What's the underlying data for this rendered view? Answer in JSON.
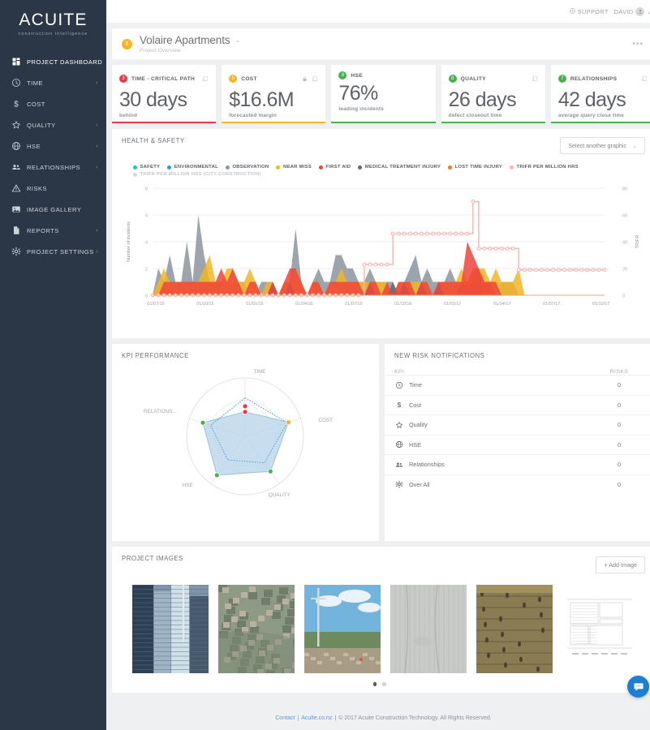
{
  "brand": {
    "logo_text": "ACUITE",
    "logo_tagline": "construction intelligence"
  },
  "topbar": {
    "support_label": "SUPPORT",
    "user_name": "DAVID",
    "support_icon": "help-circle-icon",
    "avatar_icon": "user-avatar-icon",
    "caret_icon": "chevron-down-icon"
  },
  "sidebar": {
    "items": [
      {
        "label": "PROJECT DASHBOARD",
        "icon": "grid-icon",
        "has_caret": false,
        "active": true
      },
      {
        "label": "TIME",
        "icon": "clock-icon",
        "has_caret": true,
        "active": false
      },
      {
        "label": "COST",
        "icon": "dollar-icon",
        "has_caret": false,
        "active": false
      },
      {
        "label": "QUALITY",
        "icon": "star-icon",
        "has_caret": true,
        "active": false
      },
      {
        "label": "HSE",
        "icon": "helmet-icon",
        "has_caret": true,
        "active": false
      },
      {
        "label": "RELATIONSHIPS",
        "icon": "people-icon",
        "has_caret": true,
        "active": false
      },
      {
        "label": "RISKS",
        "icon": "warning-triangle-icon",
        "has_caret": false,
        "active": false
      },
      {
        "label": "IMAGE GALLERY",
        "icon": "image-icon",
        "has_caret": false,
        "active": false
      },
      {
        "label": "REPORTS",
        "icon": "document-icon",
        "has_caret": true,
        "active": false
      },
      {
        "label": "PROJECT SETTINGS",
        "icon": "gear-icon",
        "has_caret": true,
        "active": false
      }
    ]
  },
  "project_header": {
    "badge": "6",
    "badge_color": "#f5b526",
    "title": "Volaire Apartments",
    "subtitle": "Project Overview",
    "caret_icon": "chevron-down-icon",
    "overflow_icon": "ellipsis-icon"
  },
  "kpi_cards": [
    {
      "badge": "3",
      "badge_color": "#e8394a",
      "name": "TIME - CRITICAL PATH",
      "value": "30",
      "unit": "days",
      "description": "behind",
      "bar_color": "#e8394a",
      "has_lock": false,
      "has_copy": true
    },
    {
      "badge": "5",
      "badge_color": "#f5b526",
      "name": "COST",
      "value": "$16.6M",
      "unit": "",
      "description": "forecasted margin",
      "bar_color": "#f5b526",
      "has_lock": true,
      "has_copy": true
    },
    {
      "badge": "8",
      "badge_color": "#4caf50",
      "name": "HSE",
      "value": "76%",
      "unit": "",
      "description": "leading incidents",
      "bar_color": "#4caf50",
      "has_lock": false,
      "has_copy": false
    },
    {
      "badge": "8",
      "badge_color": "#4caf50",
      "name": "QUALITY",
      "value": "26",
      "unit": "days",
      "description": "defect closeout time",
      "bar_color": "#4caf50",
      "has_lock": false,
      "has_copy": true
    },
    {
      "badge": "7",
      "badge_color": "#4caf50",
      "name": "RELATIONSHIPS",
      "value": "42",
      "unit": "days",
      "description": "average query close time",
      "bar_color": "#4caf50",
      "has_lock": false,
      "has_copy": true
    }
  ],
  "health_safety": {
    "title": "HEALTH & SAFETY",
    "select_label": "Select another graphic",
    "select_caret": "chevron-down-icon"
  },
  "kpi_performance": {
    "title": "KPI PERFORMANCE"
  },
  "risk_notifications": {
    "title": "NEW RISK NOTIFICATIONS",
    "columns": {
      "kpi": "KPI",
      "risks": "RISKS"
    },
    "rows": [
      {
        "label": "Time",
        "icon": "clock-icon",
        "risks": "0"
      },
      {
        "label": "Cost",
        "icon": "dollar-icon",
        "risks": "0"
      },
      {
        "label": "Quality",
        "icon": "star-icon",
        "risks": "0"
      },
      {
        "label": "HSE",
        "icon": "helmet-icon",
        "risks": "0"
      },
      {
        "label": "Relationships",
        "icon": "people-icon",
        "risks": "0"
      },
      {
        "label": "Over All",
        "icon": "gear-icon",
        "risks": "0"
      }
    ]
  },
  "project_images": {
    "title": "PROJECT IMAGES",
    "add_button": "+ Add Image",
    "thumbnails": [
      {
        "alt": "high-rise-towers-photo"
      },
      {
        "alt": "aerial-city-site-photo"
      },
      {
        "alt": "construction-site-crane-photo"
      },
      {
        "alt": "concrete-wall-closeup-photo"
      },
      {
        "alt": "timber-formwork-photo"
      },
      {
        "alt": "floor-plan-drawing"
      }
    ],
    "page_dots": 2,
    "active_dot": 0
  },
  "footer": {
    "contact": "Contact",
    "site": "Aculte.co.nz",
    "copyright": "© 2017 Acuite Construction Technology. All Rights Reserved.",
    "sep": "|"
  },
  "chat": {
    "icon": "chat-bubble-icon"
  },
  "chart_data": [
    {
      "type": "area",
      "name": "health-and-safety-incidents",
      "title": "HEALTH & SAFETY",
      "xlabel": "",
      "ylabel": "Number of incidents",
      "y2label": "TRIFR",
      "ylim": [
        0,
        8
      ],
      "y2lim": [
        0,
        80
      ],
      "yticks": [
        0,
        2,
        4,
        6,
        8
      ],
      "y2ticks": [
        0,
        20,
        40,
        60,
        80
      ],
      "grid": true,
      "legend_position": "top",
      "xticks": [
        "01/07/15",
        "01/10/15",
        "01/01/16",
        "01/04/16",
        "01/07/16",
        "01/10/16",
        "01/01/17",
        "01/04/17",
        "01/07/17",
        "01/10/17"
      ],
      "legend": [
        {
          "name": "SAFETY",
          "color": "#1dc9b7"
        },
        {
          "name": "ENVIRONMENTAL",
          "color": "#3498db"
        },
        {
          "name": "OBSERVATION",
          "color": "#8d949c"
        },
        {
          "name": "NEAR MISS",
          "color": "#f5b526"
        },
        {
          "name": "FIRST AID",
          "color": "#f0453a"
        },
        {
          "name": "MEDICAL TREATMENT INJURY",
          "color": "#5c6b7a"
        },
        {
          "name": "LOST TIME INJURY",
          "color": "#f07c22"
        },
        {
          "name": "TRIFR PER MILLION HRS",
          "color": "#f9b3b0"
        },
        {
          "name": "TRIFR PER MILLION HRS (CITY CONSTRUCTION)",
          "color": "#d6d9dd",
          "dim": true
        }
      ],
      "series": [
        {
          "name": "OBSERVATION",
          "color": "#8d949c",
          "values": [
            0,
            2,
            1,
            3,
            1,
            1,
            4,
            1,
            6,
            3,
            1,
            1,
            1,
            0,
            1,
            1,
            1,
            0,
            0,
            1,
            1,
            1,
            0,
            1,
            1,
            5,
            1,
            0,
            1,
            2,
            1,
            1,
            3,
            3,
            2,
            2,
            1,
            1,
            2,
            1,
            1,
            1,
            1,
            0,
            1,
            2,
            3,
            1,
            2,
            1,
            1,
            1,
            2,
            1,
            1,
            1,
            0,
            1,
            1,
            1,
            0,
            1,
            1,
            1,
            0,
            0,
            0,
            0,
            0,
            0,
            0,
            0,
            0,
            0,
            0,
            0,
            0,
            0,
            0,
            0
          ]
        },
        {
          "name": "NEAR MISS",
          "color": "#f5b526",
          "values": [
            0,
            1,
            2,
            1,
            1,
            1,
            1,
            1,
            1,
            2,
            3,
            1,
            1,
            2,
            2,
            1,
            1,
            2,
            1,
            0,
            1,
            1,
            0,
            1,
            1,
            2,
            1,
            0,
            1,
            1,
            0,
            1,
            1,
            2,
            1,
            1,
            1,
            1,
            1,
            1,
            1,
            1,
            0,
            1,
            1,
            1,
            1,
            1,
            1,
            0,
            1,
            1,
            1,
            1,
            2,
            1,
            1,
            2,
            2,
            1,
            2,
            1,
            1,
            1,
            2,
            0,
            0,
            0,
            0,
            0,
            0,
            0,
            0,
            0,
            0,
            0,
            0,
            0,
            0,
            0
          ]
        },
        {
          "name": "FIRST AID",
          "color": "#f0453a",
          "values": [
            0,
            0,
            1,
            1,
            1,
            1,
            1,
            1,
            1,
            1,
            1,
            1,
            2,
            1,
            2,
            1,
            0,
            1,
            1,
            0,
            0,
            1,
            0,
            1,
            2,
            2,
            1,
            0,
            1,
            1,
            0,
            1,
            1,
            1,
            1,
            1,
            1,
            0,
            1,
            1,
            0,
            1,
            0,
            1,
            1,
            1,
            0,
            1,
            1,
            0,
            1,
            1,
            1,
            1,
            1,
            4,
            3,
            2,
            1,
            1,
            1,
            0,
            0,
            0,
            0,
            0,
            0,
            0,
            0,
            0,
            0,
            0,
            0,
            0,
            0,
            0,
            0,
            0,
            0,
            0
          ]
        },
        {
          "name": "MEDICAL TREATMENT INJURY",
          "color": "#5c6b7a",
          "values": [
            0,
            0,
            0,
            0,
            0,
            0,
            0,
            0,
            0,
            0,
            0,
            0,
            0,
            0,
            0,
            0,
            0,
            0,
            0,
            0,
            0,
            1,
            0,
            0,
            1,
            0,
            0,
            0,
            0,
            0,
            0,
            0,
            0,
            0,
            0,
            0,
            0,
            0,
            1,
            0,
            0,
            0,
            1,
            0,
            1,
            0,
            0,
            1,
            0,
            0,
            1,
            0,
            0,
            0,
            1,
            0,
            1,
            1,
            0,
            0,
            0,
            0,
            0,
            0,
            0,
            0,
            0,
            0,
            0,
            0,
            0,
            0,
            0,
            0,
            0,
            0,
            0,
            0,
            0,
            0
          ]
        },
        {
          "name": "LOST TIME INJURY",
          "color": "#f07c22",
          "values": [
            0,
            0,
            0,
            0,
            0,
            0,
            0,
            0,
            0,
            0,
            0,
            0,
            0,
            0,
            0,
            0,
            0,
            0,
            0,
            0,
            0,
            0,
            0,
            0,
            0,
            0,
            0,
            0,
            0,
            0,
            0,
            0,
            0,
            0,
            0,
            0,
            0,
            0,
            0,
            0,
            0,
            0,
            0,
            0,
            0,
            0,
            0,
            0,
            0,
            0,
            0,
            0,
            0,
            0,
            1,
            1,
            2,
            2,
            1,
            1,
            0,
            0,
            0,
            0,
            0,
            0,
            0,
            0,
            0,
            0,
            0,
            0,
            0,
            0,
            0,
            0,
            0,
            0,
            0,
            0
          ]
        },
        {
          "name": "TRIFR PER MILLION HRS",
          "color": "#f9b3b0",
          "axis": "right",
          "values": [
            0,
            0,
            0,
            0,
            0,
            0,
            0,
            0,
            0,
            0,
            0,
            0,
            0,
            0,
            0,
            0,
            0,
            0,
            0,
            0,
            0,
            0,
            0,
            0,
            0,
            0,
            0,
            0,
            0,
            0,
            0,
            0,
            0,
            0,
            0,
            0,
            0,
            23,
            23,
            23,
            23,
            23,
            46,
            46,
            46,
            46,
            46,
            46,
            46,
            46,
            46,
            46,
            46,
            46,
            46,
            46,
            70,
            35,
            35,
            35,
            35,
            35,
            35,
            35,
            19,
            19,
            19,
            19,
            19,
            19,
            19,
            19,
            19,
            19,
            19,
            19,
            19,
            19,
            19,
            19
          ]
        }
      ]
    },
    {
      "type": "radar",
      "name": "kpi-performance-radar",
      "title": "KPI PERFORMANCE",
      "categories": [
        "TIME",
        "COST",
        "QUALITY",
        "HSE",
        "RELATIONS..."
      ],
      "rlim": [
        0,
        100
      ],
      "series": [
        {
          "name": "actual",
          "values": [
            42,
            78,
            74,
            82,
            76
          ],
          "fill": "#b6d3e8",
          "stroke": "#9dc3de"
        },
        {
          "name": "target",
          "values": [
            66,
            76,
            56,
            50,
            62
          ],
          "stroke": "#5b9bd5",
          "dashed": true
        }
      ],
      "point_colors": [
        "#e8394a",
        "#f5b526",
        "#4caf50",
        "#4caf50",
        "#4caf50"
      ]
    }
  ]
}
